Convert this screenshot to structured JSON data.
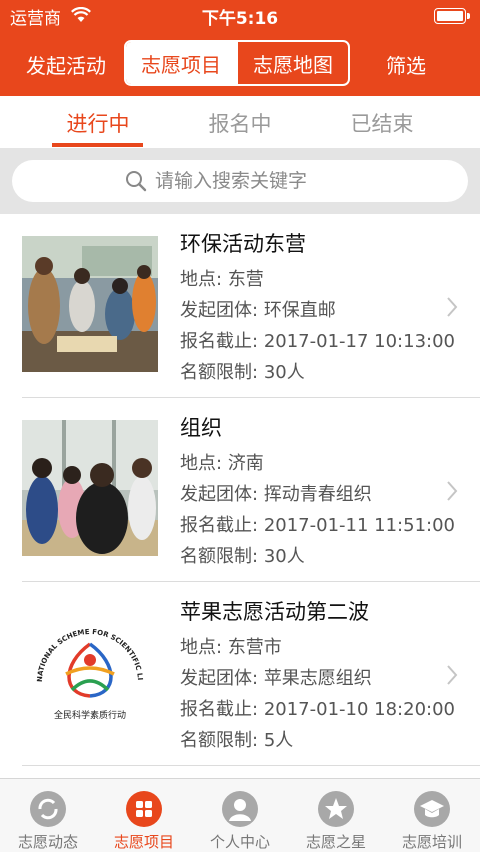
{
  "status_bar": {
    "carrier": "运营商",
    "time": "下午5:16"
  },
  "nav": {
    "left_button": "发起活动",
    "segments": [
      "志愿项目",
      "志愿地图"
    ],
    "right_button": "筛选"
  },
  "tabs": [
    "进行中",
    "报名中",
    "已结束"
  ],
  "search": {
    "placeholder": "请输入搜索关键字"
  },
  "colors": {
    "accent": "#e8471c",
    "separator": "#e4e4e4"
  },
  "field_labels": {
    "location": "地点:",
    "organizer": "发起团体:",
    "deadline": "报名截止:",
    "quota": "名额限制:"
  },
  "items": [
    {
      "title": "环保活动东营",
      "location": "东营",
      "organizer": "环保直邮",
      "deadline": "2017-01-17 10:13:00",
      "quota": "30人"
    },
    {
      "title": "组织",
      "location": "济南",
      "organizer": "挥动青春组织",
      "deadline": "2017-01-11 11:51:00",
      "quota": "30人"
    },
    {
      "title": "苹果志愿活动第二波",
      "location": "东营市",
      "organizer": "苹果志愿组织",
      "deadline": "2017-01-10 18:20:00",
      "quota": "5人"
    }
  ],
  "logo": {
    "ring_text": "NATIONAL SCHEME FOR SCIENTIFIC LITERACY",
    "bottom_text": "全民科学素质行动"
  },
  "tabbar": [
    {
      "label": "志愿动态",
      "icon": "refresh-icon"
    },
    {
      "label": "志愿项目",
      "icon": "grid-icon"
    },
    {
      "label": "个人中心",
      "icon": "person-icon"
    },
    {
      "label": "志愿之星",
      "icon": "star-icon"
    },
    {
      "label": "志愿培训",
      "icon": "graduation-cap-icon"
    }
  ]
}
